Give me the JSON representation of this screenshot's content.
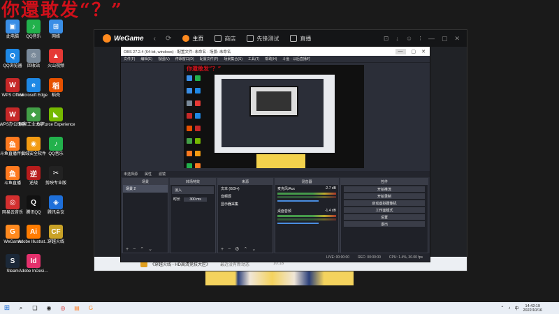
{
  "overlay": {
    "title": "你還敢发“？”"
  },
  "desktop": {
    "icons": [
      {
        "label": "此电脑",
        "glyph": "▣",
        "color": "#3a8ee6"
      },
      {
        "label": "QQ音乐",
        "glyph": "♪",
        "color": "#22b14c"
      },
      {
        "label": "网络",
        "glyph": "⊞",
        "color": "#3a8ee6"
      },
      {
        "label": "QQ浏览器",
        "glyph": "Q",
        "color": "#1e88e5"
      },
      {
        "label": "回收站",
        "glyph": "♲",
        "color": "#7a8a9a"
      },
      {
        "label": "火山视频",
        "glyph": "▲",
        "color": "#e53935"
      },
      {
        "label": "WPS Office",
        "glyph": "W",
        "color": "#c62828"
      },
      {
        "label": "Microsoft Edge",
        "glyph": "e",
        "color": "#1e88e5"
      },
      {
        "label": "稻壳",
        "glyph": "稻",
        "color": "#e65100"
      },
      {
        "label": "WPS办公助手",
        "glyph": "W",
        "color": "#c62828"
      },
      {
        "label": "国家工业大学…",
        "glyph": "◆",
        "color": "#43a047"
      },
      {
        "label": "GeForce Experience",
        "glyph": "◣",
        "color": "#76b900"
      },
      {
        "label": "斗鱼直播伴侣",
        "glyph": "鱼",
        "color": "#ff7a1f"
      },
      {
        "label": "火绒安全软件",
        "glyph": "◉",
        "color": "#f39c12"
      },
      {
        "label": "QQ音乐",
        "glyph": "♪",
        "color": "#22b14c"
      },
      {
        "label": "斗鱼直播",
        "glyph": "鱼",
        "color": "#ff7a1f"
      },
      {
        "label": "逆战",
        "glyph": "逆",
        "color": "#b71c1c"
      },
      {
        "label": "剪映专业版",
        "glyph": "✂",
        "color": "#222222"
      },
      {
        "label": "网易云音乐",
        "glyph": "◎",
        "color": "#d32f2f"
      },
      {
        "label": "腾讯QQ",
        "glyph": "Q",
        "color": "#111111"
      },
      {
        "label": "腾讯会议",
        "glyph": "◈",
        "color": "#1e6fd9"
      },
      {
        "label": "WeGame",
        "glyph": "G",
        "color": "#ff8a1f"
      },
      {
        "label": "Adobe Illustrat…",
        "glyph": "Ai",
        "color": "#ff7c00"
      },
      {
        "label": "穿越火线",
        "glyph": "CF",
        "color": "#c9a227"
      },
      {
        "label": "Steam",
        "glyph": "S",
        "color": "#1b2838"
      },
      {
        "label": "Adobe InDesi…",
        "glyph": "Id",
        "color": "#e4306c"
      }
    ]
  },
  "wegame": {
    "logo": "WeGame",
    "nav_back": "‹",
    "nav_refresh": "⟳",
    "tabs": [
      {
        "label": "主页",
        "active": true
      },
      {
        "label": "商店",
        "active": false
      },
      {
        "label": "先锋测试",
        "active": false
      },
      {
        "label": "直播",
        "active": false
      }
    ],
    "controls": [
      "⊡",
      "↓",
      "☺",
      "⁝",
      "—",
      "▢",
      "✕"
    ],
    "bottom_text": "《穿越火线 - HD高清竞技大区》",
    "bottom_text2": "最近没有新动态",
    "bottom_time": "10:18"
  },
  "obs": {
    "title": "OBS 27.2.4 (64-bit, windows) - 配置文件: 未命名 - 场景: 未命名",
    "menu": [
      "文件(F)",
      "编辑(E)",
      "视图(V)",
      "停靠窗口(D)",
      "配置文件(P)",
      "场景集合(S)",
      "工具(T)",
      "帮助(H)",
      "斗鱼 - 以后直播时"
    ],
    "status_left": "未选择源",
    "status_props": "属性",
    "status_filters": "滤镜",
    "docks": {
      "scenes": {
        "header": "场景",
        "items": [
          "场景 2"
        ]
      },
      "transitions": {
        "header": "转场特效",
        "item": "淡入",
        "duration_label": "时长",
        "duration": "300 ms"
      },
      "sources": {
        "header": "来源",
        "items": [
          "文本 (GDI+)",
          "音频源",
          "显示器采集"
        ]
      },
      "mixer": {
        "header": "混音器",
        "tracks": [
          {
            "name": "麦克风/Aux",
            "level": "-2.7 dB"
          },
          {
            "name": "桌面音频",
            "level": "-1.4 dB"
          }
        ]
      },
      "controls": {
        "header": "控件",
        "buttons": [
          "开始推流",
          "开始录制",
          "启动虚拟摄像机",
          "工作室模式",
          "设置",
          "退出"
        ]
      }
    },
    "footer": {
      "live": "LIVE: 00:00:00",
      "rec": "REC: 00:00:00",
      "cpu": "CPU: 1.4%, 30.00 fps"
    }
  },
  "taskbar": {
    "start": "⊞",
    "items": [
      "⌕",
      "❑",
      "◉",
      "◎",
      "▤",
      "G"
    ],
    "tray": [
      "⌃",
      "♪",
      "中"
    ],
    "time": "14:42:19",
    "date": "2022/10/16"
  }
}
